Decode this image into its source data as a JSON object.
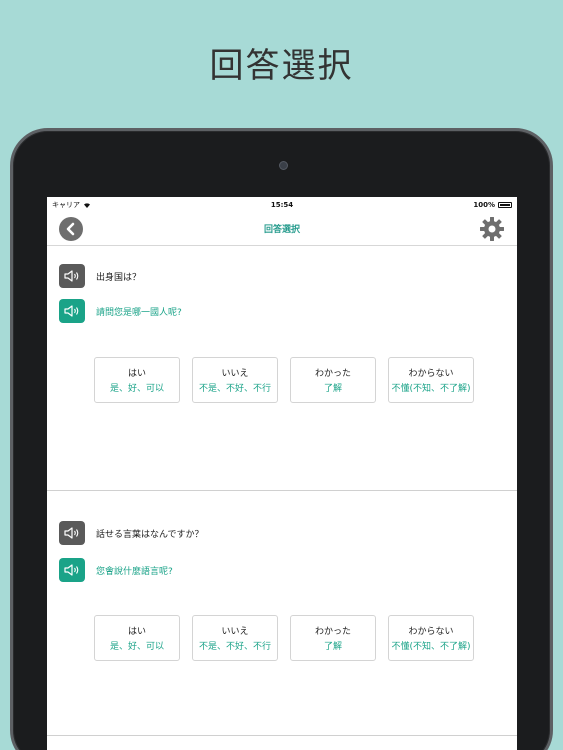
{
  "promo": {
    "title": "回答選択"
  },
  "status": {
    "carrier": "キャリア",
    "time": "15:54",
    "battery": "100%",
    "battery_level": 1.0
  },
  "nav": {
    "title": "回答選択"
  },
  "questions": [
    {
      "jp": "出身国は？",
      "zh": "請問您是哪一國人呢?",
      "answers": [
        {
          "jp": "はい",
          "zh": "是、好、可以"
        },
        {
          "jp": "いいえ",
          "zh": "不是、不好、不行"
        },
        {
          "jp": "わかった",
          "zh": "了解"
        },
        {
          "jp": "わからない",
          "zh": "不懂(不知、不了解)"
        }
      ]
    },
    {
      "jp": "話せる言葉はなんですか？",
      "zh": "您會說什麼語言呢?",
      "answers": [
        {
          "jp": "はい",
          "zh": "是、好、可以"
        },
        {
          "jp": "いいえ",
          "zh": "不是、不好、不行"
        },
        {
          "jp": "わかった",
          "zh": "了解"
        },
        {
          "jp": "わからない",
          "zh": "不懂(不知、不了解)"
        }
      ]
    }
  ],
  "colors": {
    "accent": "#1aa388",
    "background": "#a7dad6",
    "speaker_dark": "#5a5a5a"
  },
  "icons": {
    "back": "chevron-left-icon",
    "settings": "gear-icon",
    "speaker": "speaker-icon",
    "wifi": "wifi-icon"
  }
}
